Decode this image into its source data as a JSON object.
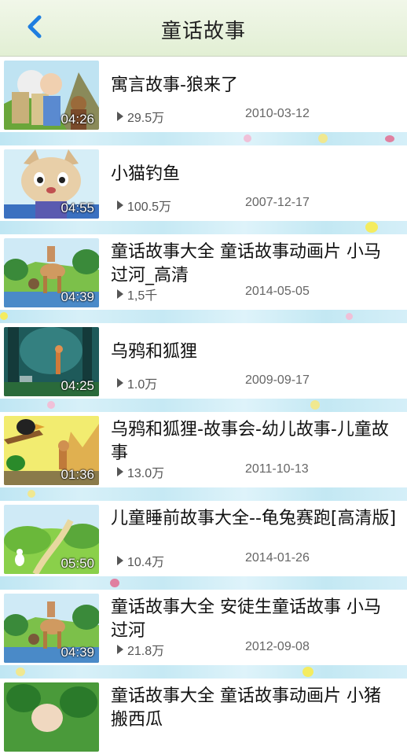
{
  "nav": {
    "title": "童话故事",
    "back_icon": "chevron-left-icon",
    "accent": "#1f7ee0"
  },
  "videos": [
    {
      "title": "寓言故事-狼来了",
      "duration": "04:26",
      "views": "29.5万",
      "date": "2010-03-12"
    },
    {
      "title": "小猫钓鱼",
      "duration": "04:55",
      "views": "100.5万",
      "date": "2007-12-17"
    },
    {
      "title": "童话故事大全 童话故事动画片 小马过河_高清",
      "duration": "04:39",
      "views": "1,5千",
      "date": "2014-05-05"
    },
    {
      "title": "乌鸦和狐狸",
      "duration": "04:25",
      "views": "1.0万",
      "date": "2009-09-17"
    },
    {
      "title": "乌鸦和狐狸-故事会-幼儿故事-儿童故事",
      "duration": "01:36",
      "views": "13.0万",
      "date": "2011-10-13"
    },
    {
      "title": "儿童睡前故事大全--龟兔赛跑[高清版]",
      "duration": "05:50",
      "views": "10.4万",
      "date": "2014-01-26"
    },
    {
      "title": "童话故事大全 安徒生童话故事 小马过河",
      "duration": "04:39",
      "views": "21.8万",
      "date": "2012-09-08"
    },
    {
      "title": "童话故事大全 童话故事动画片 小猪搬西瓜",
      "duration": "",
      "views": "",
      "date": ""
    }
  ]
}
